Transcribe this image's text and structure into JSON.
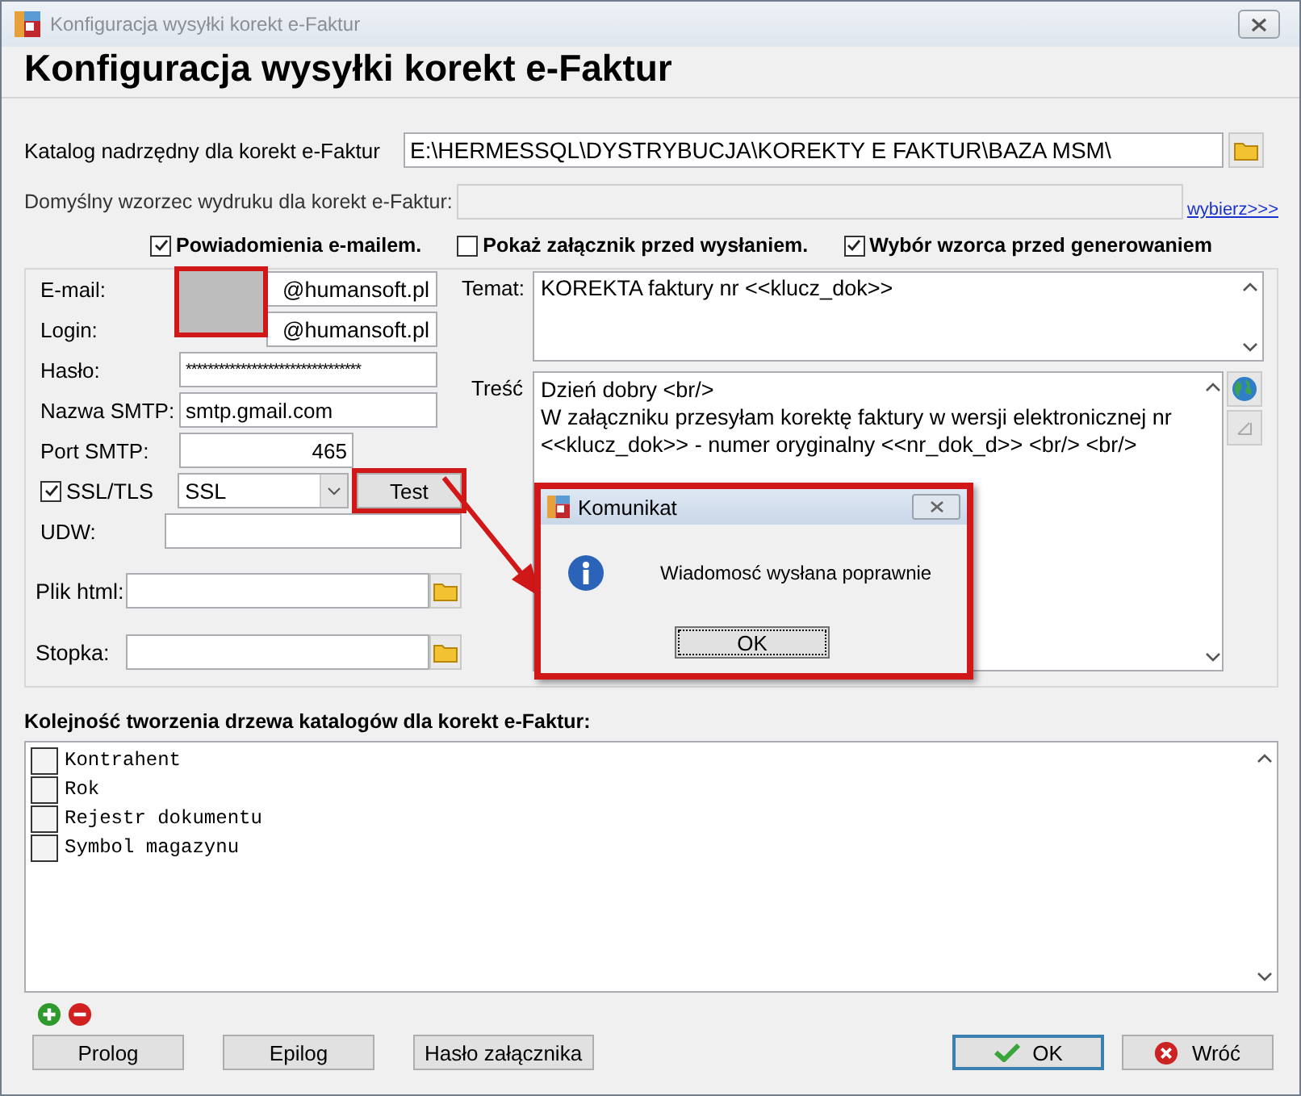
{
  "window": {
    "title": "Konfiguracja wysyłki korekt e-Faktur"
  },
  "header": "Konfiguracja wysyłki korekt e-Faktur",
  "catalog": {
    "label": "Katalog nadrzędny dla korekt e-Faktur",
    "value": "E:\\HERMESSQL\\DYSTRYBUCJA\\KOREKTY E FAKTUR\\BAZA MSM\\"
  },
  "template": {
    "label": "Domyślny wzorzec wydruku dla korekt e-Faktur:",
    "disabled": true,
    "link": "wybierz>>>"
  },
  "options": [
    {
      "label": "Powiadomienia e-mailem.",
      "checked": true
    },
    {
      "label": "Pokaż załącznik przed wysłaniem.",
      "checked": false
    },
    {
      "label": "Wybór wzorca przed generowaniem",
      "checked": true
    }
  ],
  "mail": {
    "email_label": "E-mail:",
    "email_domain": "@humansoft.pl",
    "login_label": "Login:",
    "login_domain": "@humansoft.pl",
    "redaction_highlighted": true,
    "password_label": "Hasło:",
    "password": "********************************",
    "smtp_label": "Nazwa SMTP:",
    "smtp": "smtp.gmail.com",
    "port_label": "Port SMTP:",
    "port": "465",
    "ssl": {
      "label": "SSL/TLS",
      "checked": true
    },
    "ssl_mode": "SSL",
    "test_button": {
      "label": "Test",
      "highlighted": true
    },
    "udw_label": "UDW:",
    "html_label": "Plik html:",
    "footer_label": "Stopka:"
  },
  "message": {
    "subject_label": "Temat:",
    "subject": "KOREKTA faktury nr <<klucz_dok>>",
    "body_label": "Treść",
    "body": [
      "Dzień dobry <br/>",
      "W załączniku przesyłam korektę faktury w wersji elektronicznej nr",
      "<<klucz_dok>> - numer oryginalny <<nr_dok_d>> <br/> <br/>"
    ]
  },
  "dialog": {
    "title": "Komunikat",
    "text": "Wiadomosć wysłana poprawnie",
    "ok": "OK",
    "highlighted": true
  },
  "tree_order": {
    "label": "Kolejność tworzenia drzewa katalogów dla korekt e-Faktur:",
    "items": [
      {
        "label": "Kontrahent",
        "checked": false
      },
      {
        "label": "Rok",
        "checked": false
      },
      {
        "label": "Rejestr dokumentu",
        "checked": false
      },
      {
        "label": "Symbol magazynu",
        "checked": false
      }
    ]
  },
  "buttons": [
    {
      "label": "Prolog",
      "kind": "plain"
    },
    {
      "label": "Epilog",
      "kind": "plain"
    },
    {
      "label": "Hasło załącznika",
      "kind": "plain"
    },
    {
      "label": "OK",
      "kind": "ok"
    },
    {
      "label": "Wróć",
      "kind": "cancel"
    }
  ]
}
